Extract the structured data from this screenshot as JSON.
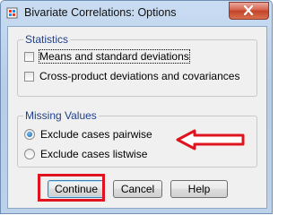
{
  "window": {
    "title": "Bivariate Correlations: Options"
  },
  "icons": {
    "app": "spss-dialog-icon",
    "close": "close-icon",
    "annotation_arrow": "left-arrow-icon"
  },
  "colors": {
    "group_label": "#1e3f8a",
    "annotation": "#e0141e",
    "radio_selected": "#1460a8"
  },
  "statistics": {
    "label": "Statistics",
    "options": [
      {
        "label": "Means and standard deviations",
        "checked": false
      },
      {
        "label": "Cross-product deviations and covariances",
        "checked": false
      }
    ]
  },
  "missing_values": {
    "label": "Missing Values",
    "options": [
      {
        "label": "Exclude cases pairwise",
        "selected": true
      },
      {
        "label": "Exclude cases listwise",
        "selected": false
      }
    ]
  },
  "buttons": {
    "continue": "Continue",
    "cancel": "Cancel",
    "help": "Help"
  }
}
